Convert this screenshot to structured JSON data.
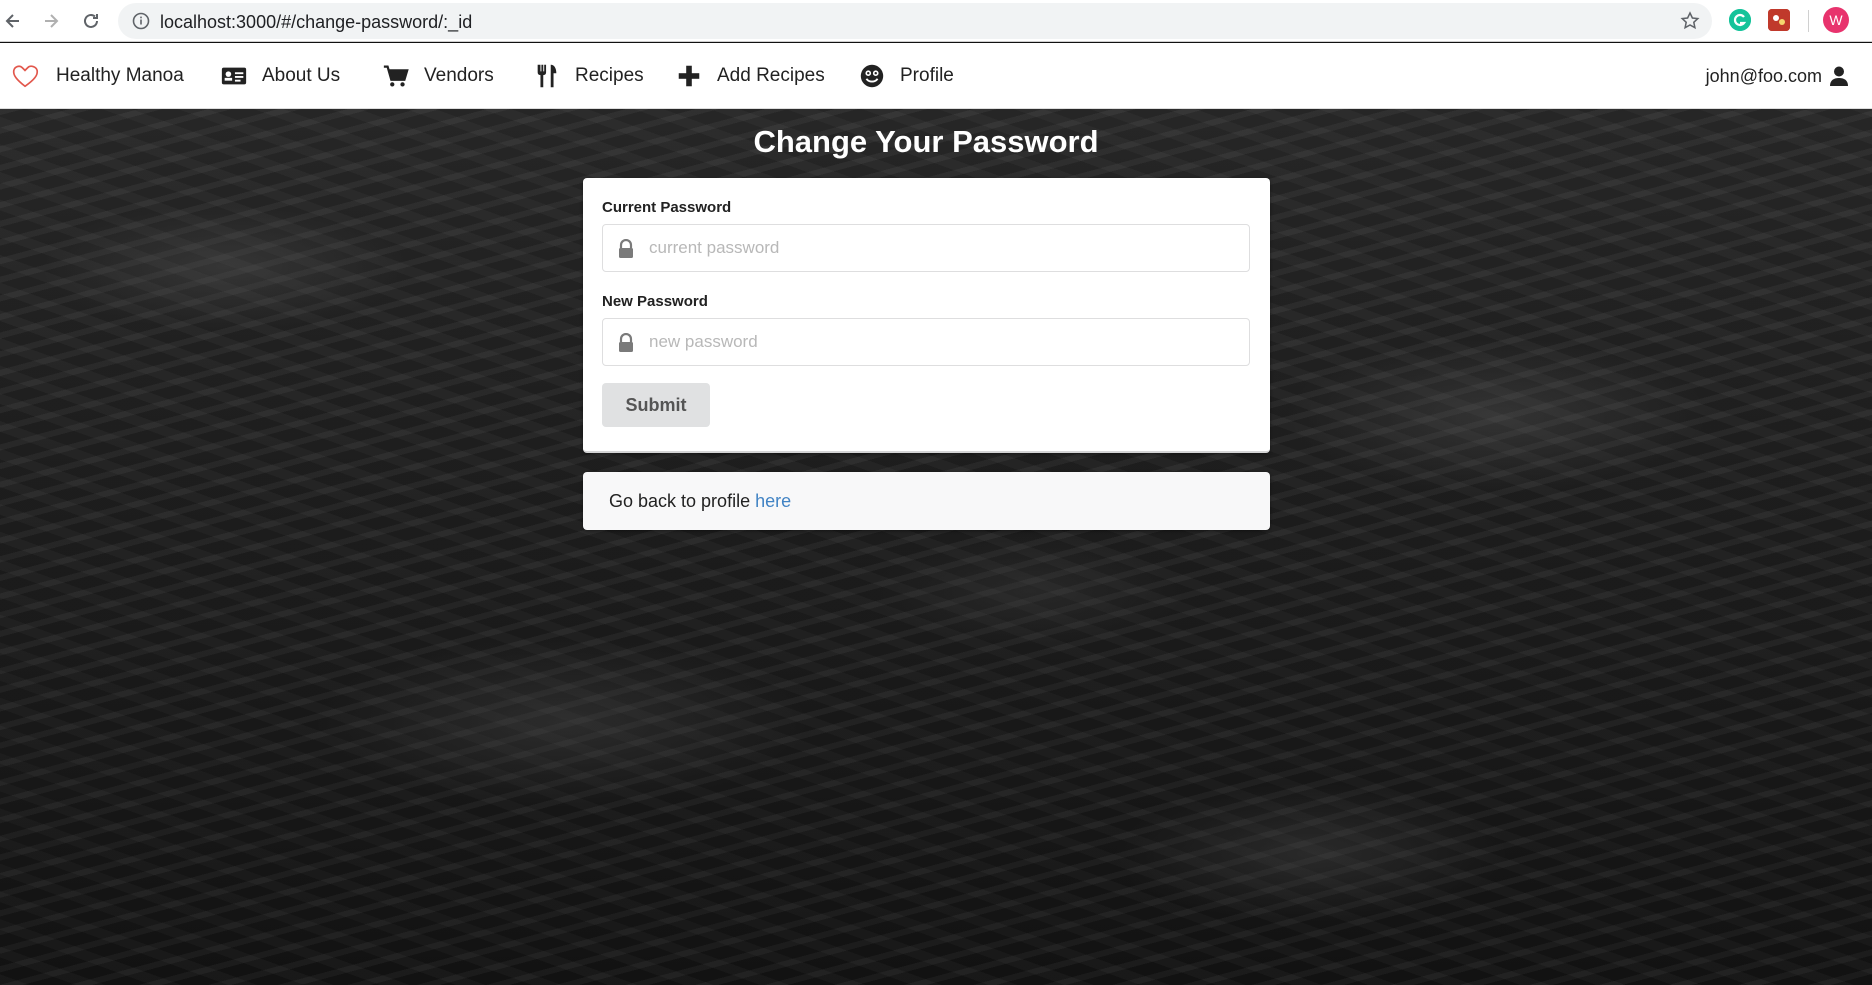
{
  "browser": {
    "url": "localhost:3000/#/change-password/:_id",
    "extension_avatar_letter": "W"
  },
  "navbar": {
    "brand": "Healthy Manoa",
    "items": [
      {
        "label": "About Us",
        "icon": "id-card-icon"
      },
      {
        "label": "Vendors",
        "icon": "cart-icon"
      },
      {
        "label": "Recipes",
        "icon": "utensils-icon"
      },
      {
        "label": "Add Recipes",
        "icon": "plus-icon"
      },
      {
        "label": "Profile",
        "icon": "smile-icon"
      }
    ],
    "user": "john@foo.com"
  },
  "page": {
    "title": "Change Your Password"
  },
  "form": {
    "current_label": "Current Password",
    "current_placeholder": "current password",
    "new_label": "New Password",
    "new_placeholder": "new password",
    "submit_label": "Submit"
  },
  "back": {
    "text": "Go back to profile ",
    "link": "here"
  },
  "colors": {
    "brand_heart": "#e2574c",
    "link": "#4183c4",
    "button_bg": "#e0e1e2"
  }
}
